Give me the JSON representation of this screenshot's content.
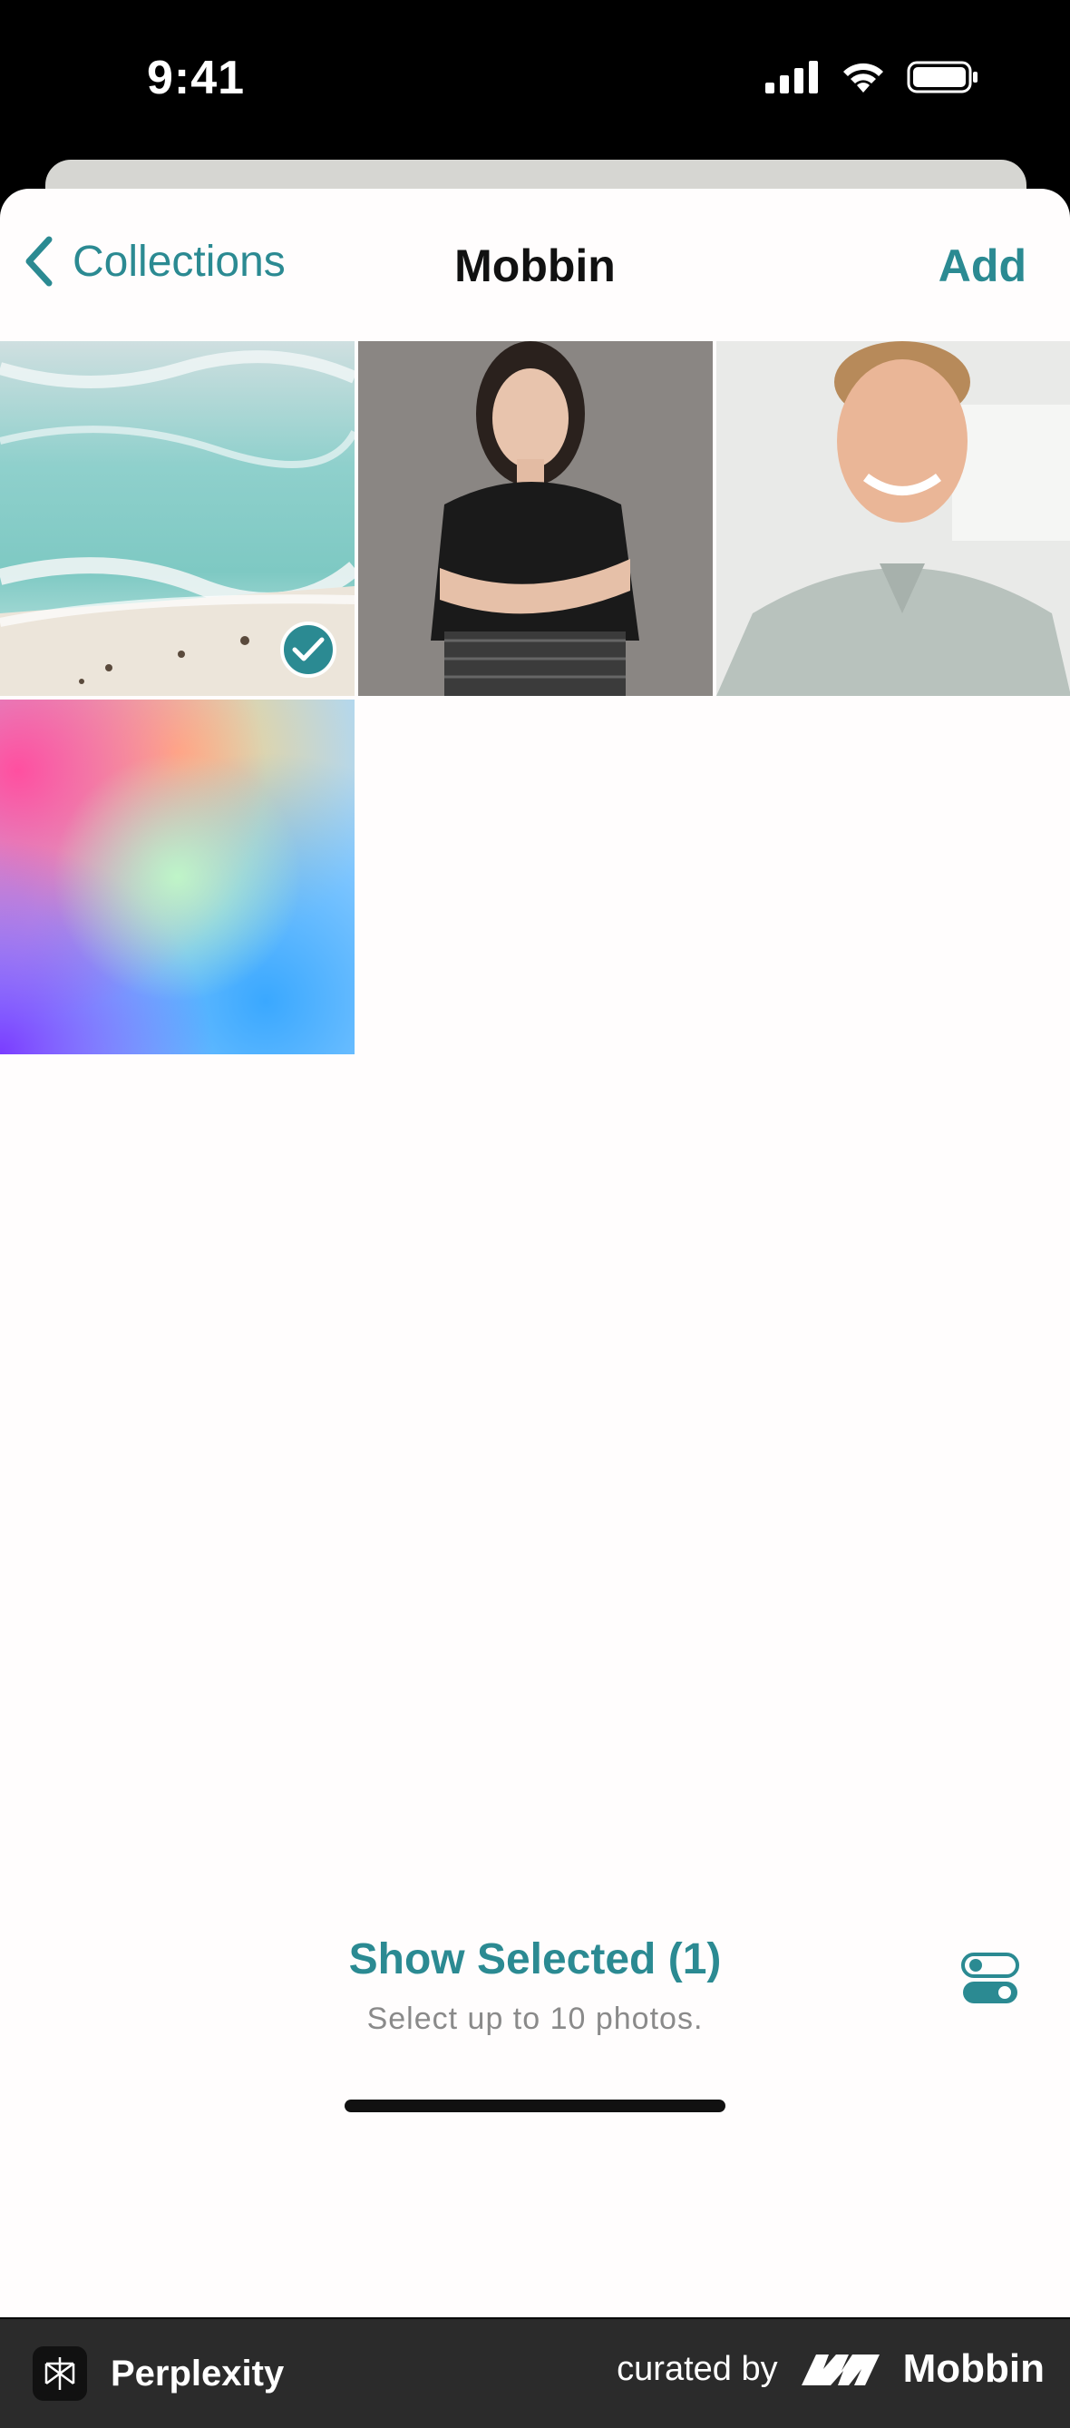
{
  "status_bar": {
    "time": "9:41"
  },
  "nav": {
    "back_label": "Collections",
    "title": "Mobbin",
    "add_label": "Add"
  },
  "photos": [
    {
      "subject": "aerial beach",
      "selected": true
    },
    {
      "subject": "woman portrait",
      "selected": false
    },
    {
      "subject": "man portrait",
      "selected": false
    },
    {
      "subject": "gradient",
      "selected": false
    }
  ],
  "bottom": {
    "show_selected": "Show Selected (1)",
    "hint": "Select up to 10 photos."
  },
  "footer": {
    "app_name": "Perplexity",
    "curated_by": "curated by",
    "brand": "Mobbin"
  },
  "colors": {
    "accent": "#2b8a92"
  }
}
